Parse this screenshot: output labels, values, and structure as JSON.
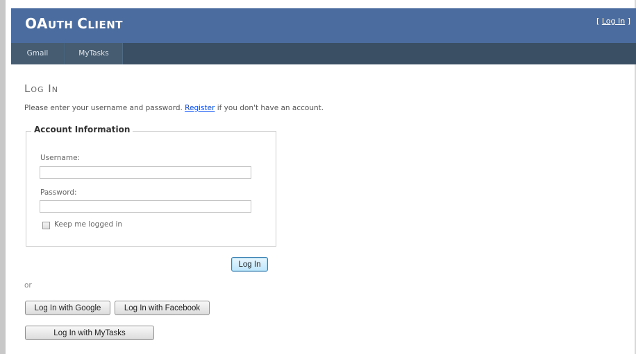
{
  "header": {
    "title_first_letter": "OA",
    "title_rest_1": "UTH ",
    "title_first_letter_2": "C",
    "title_rest_2": "LIENT",
    "login_prefix": "[ ",
    "login_link": "Log In",
    "login_suffix": " ]"
  },
  "nav": {
    "items": [
      {
        "label": "Gmail"
      },
      {
        "label": "MyTasks"
      }
    ]
  },
  "main": {
    "page_title": "Log In",
    "intro_before": "Please enter your username and password. ",
    "intro_link": "Register",
    "intro_after": " if you don't have an account.",
    "fieldset_legend": "Account Information",
    "username_label": "Username:",
    "username_value": "",
    "password_label": "Password:",
    "password_value": "",
    "remember_label": "Keep me logged in",
    "remember_checked": false,
    "login_button": "Log In",
    "or_text": "or",
    "google_button": "Log In with Google",
    "facebook_button": "Log In with Facebook",
    "mytasks_button": "Log In with MyTasks"
  },
  "colors": {
    "header_bg": "#4b6c9e",
    "nav_bg": "#3a4f63",
    "link": "#034af3"
  }
}
